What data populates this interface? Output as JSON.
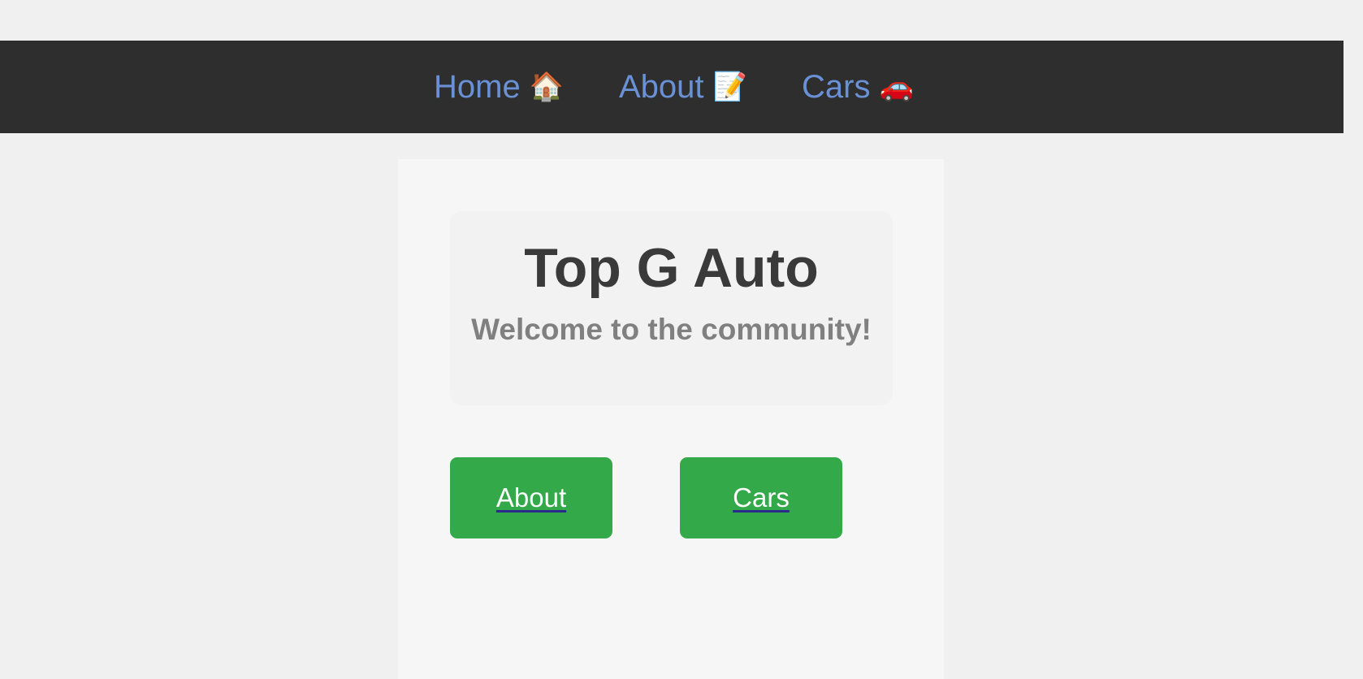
{
  "nav": {
    "items": [
      {
        "label": "Home",
        "emoji": "🏠"
      },
      {
        "label": "About",
        "emoji": "📝"
      },
      {
        "label": "Cars",
        "emoji": "🚗"
      }
    ]
  },
  "hero": {
    "title": "Top G Auto",
    "subtitle": "Welcome to the community!"
  },
  "buttons": {
    "about_label": "About",
    "cars_label": "Cars"
  },
  "colors": {
    "page_background": "#f0f0f0",
    "navbar_background": "#2e2e2e",
    "nav_link": "#6a91d6",
    "button_green": "#34a94a",
    "title_text": "#3a3a3a",
    "subtitle_text": "#808080"
  }
}
